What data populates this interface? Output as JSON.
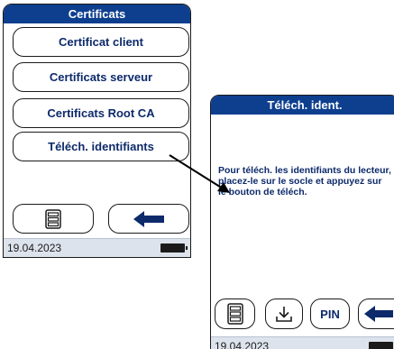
{
  "screen1": {
    "title": "Certificats",
    "buttons": [
      {
        "label": "Certificat client"
      },
      {
        "label": "Certificats serveur"
      },
      {
        "label": "Certificats Root CA"
      },
      {
        "label": "Téléch. identifiants"
      }
    ],
    "nav": {
      "menu_icon": "list-menu-icon",
      "back_icon": "arrow-left-icon"
    },
    "status": {
      "date": "19.04.2023",
      "battery_icon": "battery-full-icon"
    }
  },
  "screen2": {
    "title": "Téléch. ident.",
    "message": "Pour téléch. les identifiants du lecteur, placez-le sur le socle et appuyez sur le bouton de téléch.",
    "nav": {
      "menu_icon": "list-menu-icon",
      "download_icon": "download-icon",
      "pin_label": "PIN",
      "back_icon": "arrow-left-icon"
    },
    "status": {
      "date": "19.04.2023",
      "battery_icon": "battery-full-icon"
    }
  },
  "colors": {
    "accent": "#0e3f8f",
    "text": "#0d2a6b",
    "statusbar": "#dde3ec"
  }
}
